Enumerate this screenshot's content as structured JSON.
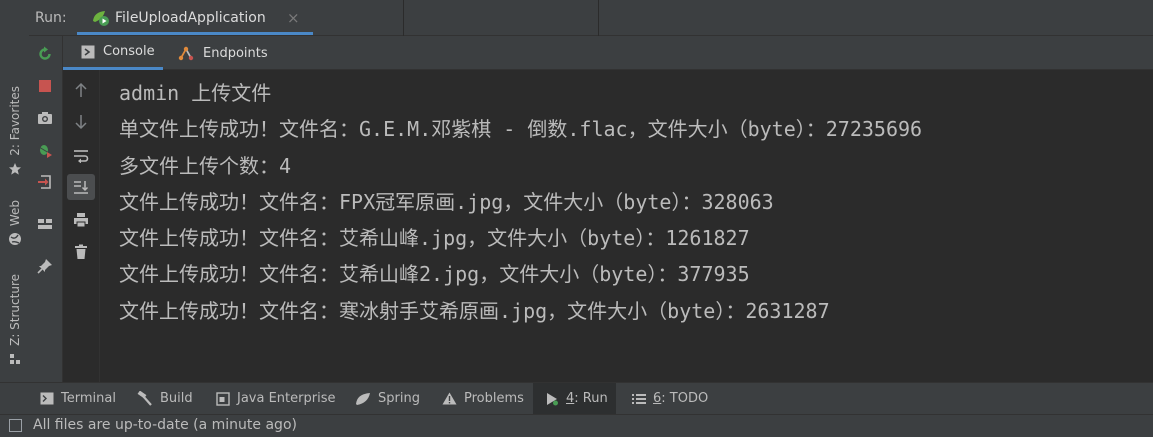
{
  "run_bar": {
    "label": "Run:",
    "tab_title": "FileUploadApplication",
    "tab_close": "×"
  },
  "side_stripe": {
    "favorites": "2: Favorites",
    "web": "Web",
    "structure": "Z: Structure"
  },
  "console_tabs": {
    "console": "Console",
    "endpoints": "Endpoints"
  },
  "console_lines": [
    "admin 上传文件",
    "单文件上传成功！文件名：G.E.M.邓紫棋 - 倒数.flac，文件大小（byte）：27235696",
    "多文件上传个数：4",
    "文件上传成功！文件名：FPX冠军原画.jpg，文件大小（byte）：328063",
    "文件上传成功！文件名：艾希山峰.jpg，文件大小（byte）：1261827",
    "文件上传成功！文件名：艾希山峰2.jpg，文件大小（byte）：377935",
    "文件上传成功！文件名：寒冰射手艾希原画.jpg，文件大小（byte）：2631287"
  ],
  "bottom_tabs": {
    "terminal": "Terminal",
    "build": "Build",
    "java_enterprise": "Java Enterprise",
    "spring": "Spring",
    "problems": "Problems",
    "run_num": "4",
    "run_text": ": Run",
    "todo_num": "6",
    "todo_text": ": TODO"
  },
  "status": {
    "text": "All files are up-to-date (a minute ago)"
  },
  "colors": {
    "accent": "#4a88c7",
    "rerun_green": "#499c54",
    "stop_red": "#c75450",
    "background": "#2b2b2b",
    "panel": "#3c3f41"
  }
}
